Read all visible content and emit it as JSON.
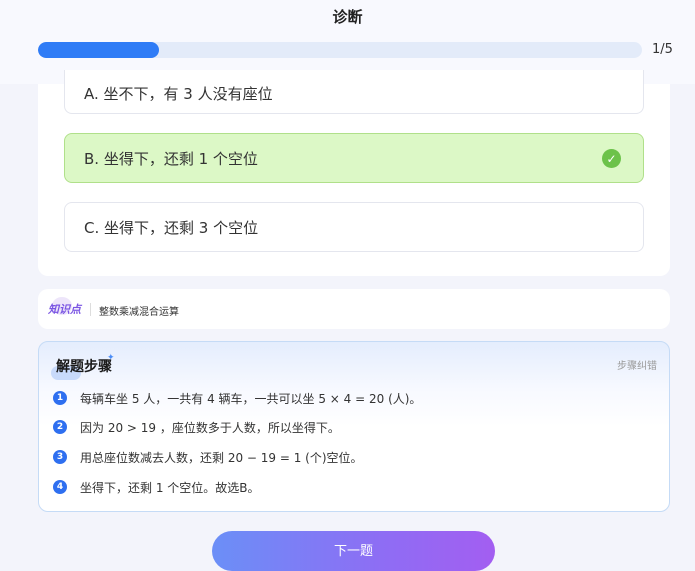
{
  "header": {
    "title": "诊断",
    "progress_text": "1/5",
    "progress_fraction": 0.2
  },
  "options": [
    {
      "label": "A.  坐不下，有 3 人没有座位"
    },
    {
      "label": "B.  坐得下，还剩 1 个空位",
      "selected": true
    },
    {
      "label": "C.  坐得下，还剩 3 个空位"
    }
  ],
  "knowledge": {
    "logo": "知识点",
    "topic": "整数乘减混合运算"
  },
  "steps": {
    "title": "解题步骤",
    "link": "步骤纠错",
    "items": [
      {
        "num": "1",
        "text": "每辆车坐 5 人，一共有 4 辆车，一共可以坐 5 × 4 = 20 (人)。"
      },
      {
        "num": "2",
        "text": "因为 20 > 19 ，座位数多于人数，所以坐得下。"
      },
      {
        "num": "3",
        "text": "用总座位数减去人数，还剩 20 − 19 = 1 (个)空位。"
      },
      {
        "num": "4",
        "text": "坐得下，还剩 1 个空位。故选B。"
      }
    ]
  },
  "footer": {
    "next_label": "下一题"
  },
  "colors": {
    "accent": "#2f7cf6",
    "correct_bg": "#dcf8c6",
    "correct_check": "#6cc24a"
  }
}
